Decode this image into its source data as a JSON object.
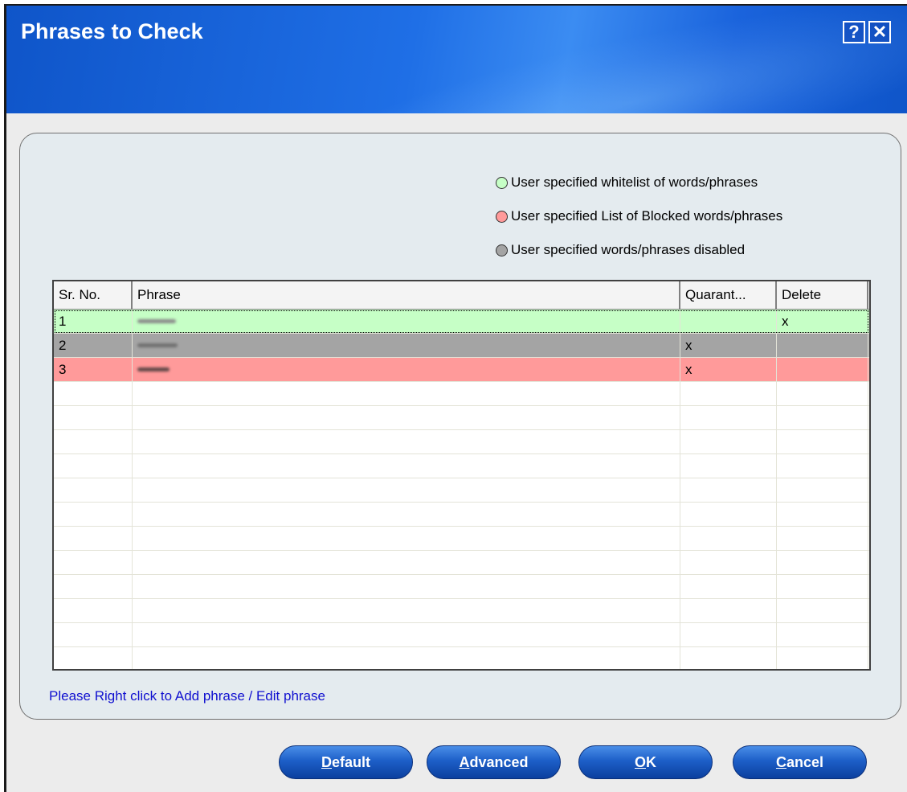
{
  "window": {
    "title": "Phrases to Check",
    "help_glyph": "?",
    "close_glyph": "✕"
  },
  "legend": [
    {
      "label": "User specified whitelist of words/phrases",
      "color": "#c6ffc6"
    },
    {
      "label": "User specified List of Blocked words/phrases",
      "color": "#ff9a9a"
    },
    {
      "label": "User specified words/phrases disabled",
      "color": "#a4a4a4"
    }
  ],
  "table": {
    "columns": [
      "Sr. No.",
      "Phrase",
      "Quarant...",
      "Delete"
    ],
    "rows": [
      {
        "sr": "1",
        "phrase": "",
        "quarantine": "",
        "delete": "x",
        "status": "whitelist"
      },
      {
        "sr": "2",
        "phrase": "",
        "quarantine": "x",
        "delete": "",
        "status": "disabled"
      },
      {
        "sr": "3",
        "phrase": "",
        "quarantine": "x",
        "delete": "",
        "status": "blocked"
      }
    ],
    "empty_rows": 12
  },
  "hint": "Please Right click to Add phrase / Edit phrase",
  "buttons": {
    "default_first": "D",
    "default_rest": "efault",
    "advanced_first": "A",
    "advanced_rest": "dvanced",
    "ok_first": "O",
    "ok_rest": "K",
    "cancel_first": "C",
    "cancel_rest": "ancel"
  }
}
